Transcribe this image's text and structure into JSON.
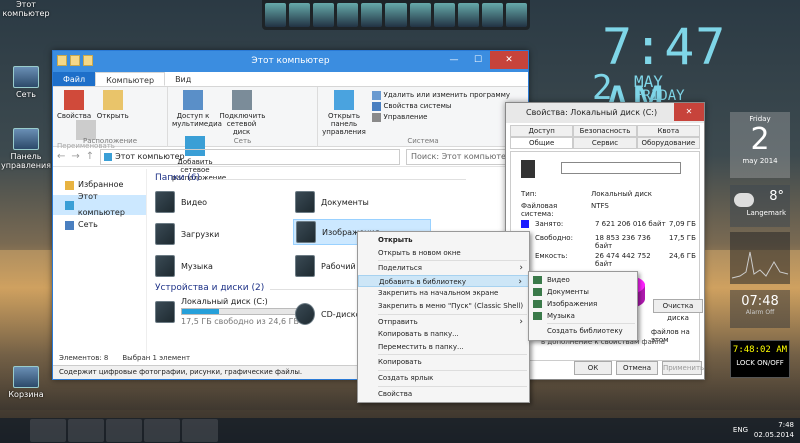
{
  "desktop": {
    "icons": [
      {
        "label": "Этот компьютер"
      },
      {
        "label": "Сеть"
      },
      {
        "label": "Панель управления"
      },
      {
        "label": "Корзина"
      }
    ],
    "clock": {
      "time": "7:47 AM",
      "day_num": "2",
      "month": "MAY",
      "weekday": "FRIDAY"
    }
  },
  "explorer": {
    "title": "Этот компьютер",
    "tabs": [
      "Файл",
      "Компьютер",
      "Вид"
    ],
    "ribbon": {
      "group1": {
        "label": "Расположение",
        "buttons": [
          "Свойства",
          "Открыть",
          "Переименовать"
        ]
      },
      "group2": {
        "label": "Сеть",
        "buttons": [
          "Доступ к мультимедиа",
          "Подключить сетевой диск",
          "Добавить сетевое расположение"
        ]
      },
      "group3": {
        "label": "Система",
        "buttons": [
          "Открыть панель управления"
        ],
        "lines": [
          "Удалить или изменить программу",
          "Свойства системы",
          "Управление"
        ]
      }
    },
    "address": "Этот компьютер",
    "search_placeholder": "Поиск: Этот компьютер",
    "nav": [
      "Избранное",
      "Этот компьютер",
      "Сеть"
    ],
    "folders_header": "Папки (6)",
    "folders": [
      "Видео",
      "Документы",
      "Загрузки",
      "Изображения",
      "Музыка",
      "Рабочий ст"
    ],
    "devices_header": "Устройства и диски (2)",
    "drive": {
      "name": "Локальный диск (C:)",
      "free": "17,5 ГБ свободно из 24,6 ГБ",
      "used_fraction": 0.29
    },
    "cd": "CD-дисково",
    "status_items": "Элементов: 8",
    "status_selected": "Выбран 1 элемент",
    "status_desc": "Содержит цифровые фотографии, рисунки, графические файлы."
  },
  "context_menu": {
    "items": [
      "Открыть",
      "Открыть в новом окне",
      "Поделиться",
      "Добавить в библиотеку",
      "Закрепить на начальном экране",
      "Закрепить в меню \"Пуск\" (Classic Shell)",
      "Отправить",
      "Копировать в папку...",
      "Переместить в папку...",
      "Копировать",
      "Создать ярлык",
      "Свойства"
    ],
    "submenu": [
      "Видео",
      "Документы",
      "Изображения",
      "Музыка",
      "Создать библиотеку"
    ]
  },
  "properties": {
    "title": "Свойства: Локальный диск (C:)",
    "tabs_row1": [
      "Доступ",
      "Безопасность",
      "Квота"
    ],
    "tabs_row2": [
      "Общие",
      "Сервис",
      "Оборудование"
    ],
    "type_label": "Тип:",
    "type_value": "Локальный диск",
    "fs_label": "Файловая система:",
    "fs_value": "NTFS",
    "used_label": "Занято:",
    "used_bytes": "7 621 206 016 байт",
    "used_gb": "7,09 ГБ",
    "free_label": "Свободно:",
    "free_bytes": "18 853 236 736 байт",
    "free_gb": "17,5 ГБ",
    "cap_label": "Емкость:",
    "cap_bytes": "26 474 442 752 байт",
    "cap_gb": "24,6 ГБ",
    "clean_btn": "Очистка диска",
    "partial1": "файлов на этом",
    "partial2": "в дополнение к свойствам файла",
    "ok": "ОК",
    "cancel": "Отмена",
    "apply": "Применить",
    "colors": {
      "used": "#1a1aff",
      "free": "#ff22ff"
    }
  },
  "widgets": {
    "cal_day": "Friday",
    "cal_num": "2",
    "cal_month": "may 2014",
    "temp": "8°",
    "city": "Langemark",
    "clock_time": "07:48",
    "clock_sub": "Alarm Off",
    "lcd_time": "7:48:02 AM",
    "lock_label": "LOCK ON/OFF"
  },
  "taskbar": {
    "lang": "ENG",
    "time": "7:48",
    "date": "02.05.2014"
  }
}
